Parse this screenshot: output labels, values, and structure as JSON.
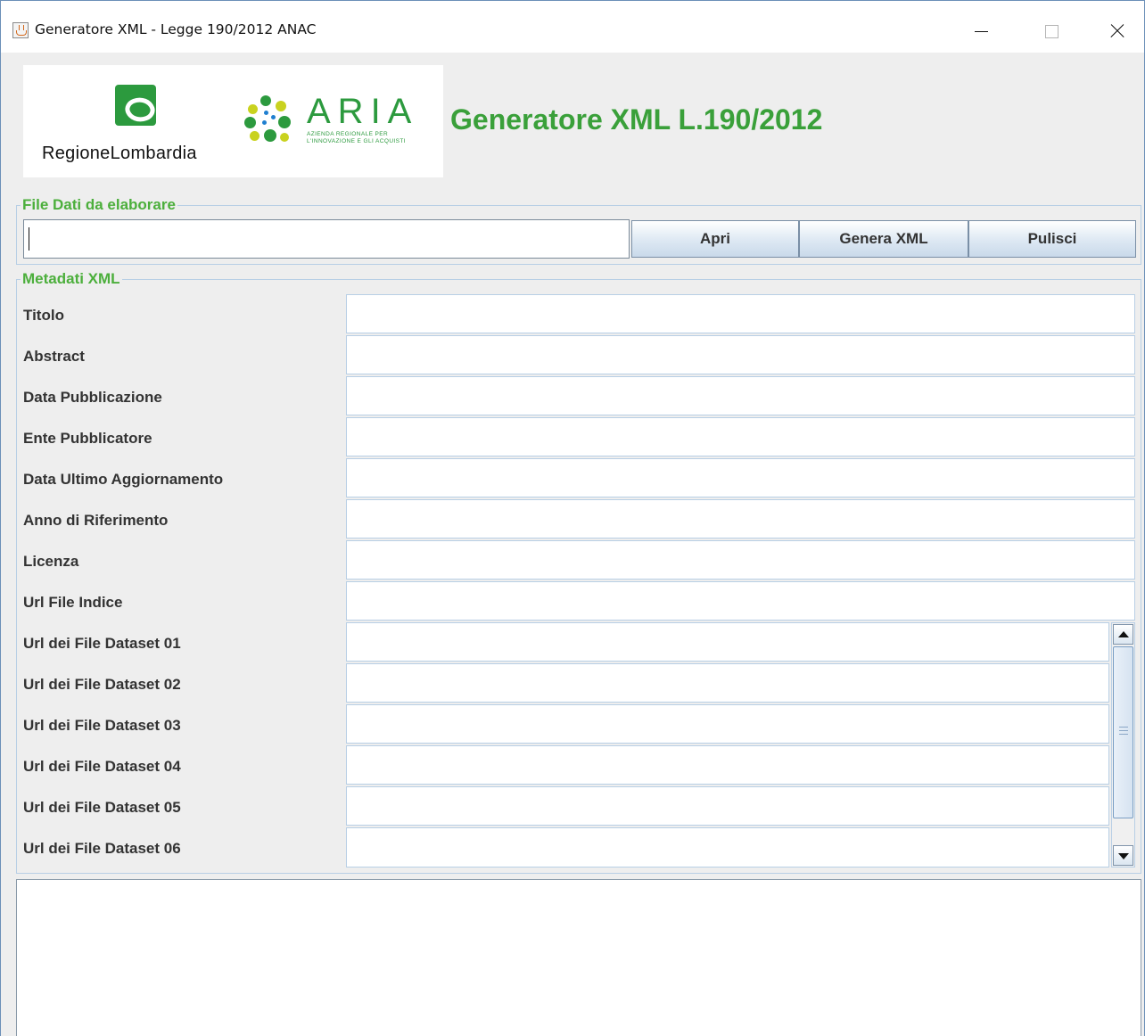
{
  "window": {
    "title": "Generatore XML - Legge 190/2012 ANAC",
    "minimize_label": "",
    "maximize_label": "",
    "close_label": ""
  },
  "header": {
    "region_logo_text": "RegioneLombardia",
    "aria_logo_text": "ARIA",
    "aria_logo_subtitle_1": "AZIENDA REGIONALE PER",
    "aria_logo_subtitle_2": "L'INNOVAZIONE E GLI ACQUISTI",
    "app_title": "Generatore XML L.190/2012"
  },
  "file_section": {
    "legend": "File Dati da elaborare",
    "file_path_value": "",
    "buttons": {
      "open": "Apri",
      "generate": "Genera XML",
      "clear": "Pulisci"
    }
  },
  "metadata_section": {
    "legend": "Metadati XML",
    "fields": [
      {
        "label": "Titolo",
        "value": ""
      },
      {
        "label": "Abstract",
        "value": ""
      },
      {
        "label": "Data Pubblicazione",
        "value": ""
      },
      {
        "label": "Ente Pubblicatore",
        "value": ""
      },
      {
        "label": "Data Ultimo Aggiornamento",
        "value": ""
      },
      {
        "label": "Anno di Riferimento",
        "value": ""
      },
      {
        "label": "Licenza",
        "value": ""
      },
      {
        "label": "Url File Indice",
        "value": ""
      }
    ],
    "dataset_fields": [
      {
        "label": "Url dei File Dataset 01",
        "value": ""
      },
      {
        "label": "Url dei File Dataset 02",
        "value": ""
      },
      {
        "label": "Url dei File Dataset 03",
        "value": ""
      },
      {
        "label": "Url dei File Dataset 04",
        "value": ""
      },
      {
        "label": "Url dei File Dataset 05",
        "value": ""
      },
      {
        "label": "Url dei File Dataset 06",
        "value": ""
      }
    ]
  },
  "output": {
    "log_text": ""
  },
  "colors": {
    "accent_green": "#3aa03a",
    "legend_green": "#4caf3c",
    "border_blue": "#b8cfe5"
  }
}
